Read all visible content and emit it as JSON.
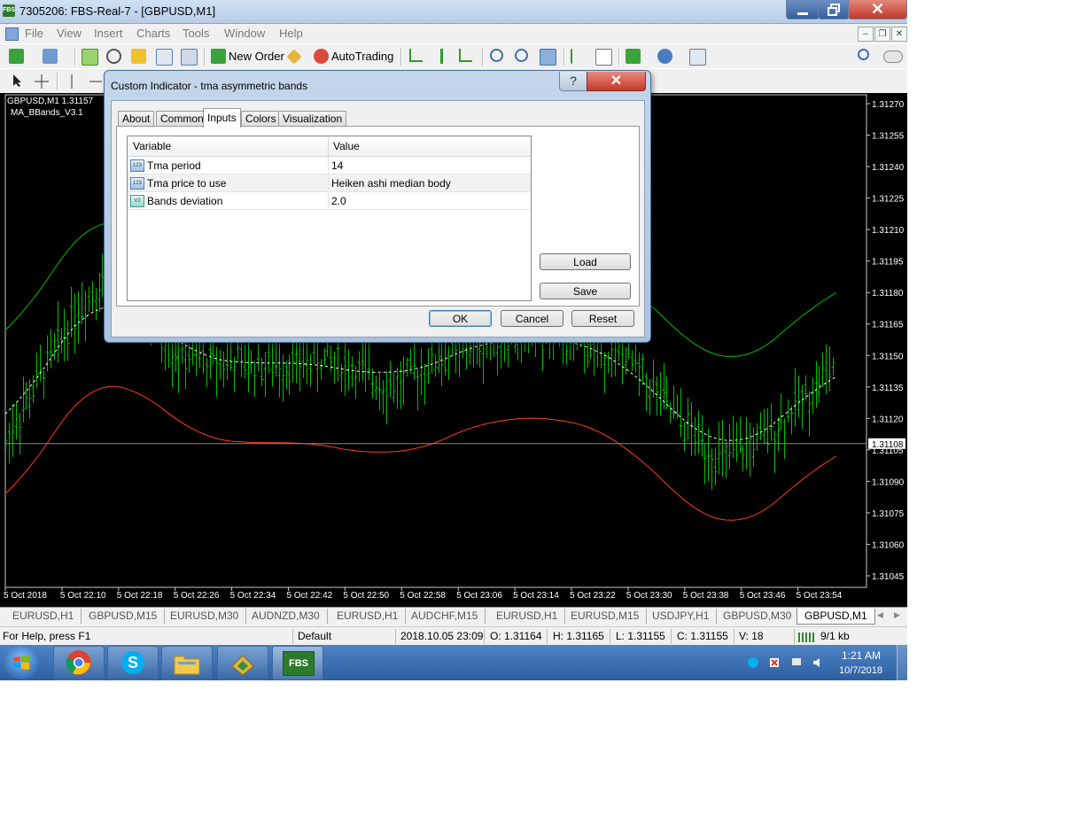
{
  "window": {
    "title": "7305206: FBS-Real-7 - [GBPUSD,M1]",
    "app_icon": "FBS"
  },
  "menu": [
    "File",
    "View",
    "Insert",
    "Charts",
    "Tools",
    "Window",
    "Help"
  ],
  "toolbar": {
    "new_order": "New Order",
    "autotrading": "AutoTrading"
  },
  "chart": {
    "symbol_info": "GBPUSD,M1  1.31157",
    "indicator": "MA_BBands_V3.1",
    "current_price": "1.31108",
    "price_labels": [
      "1.31270",
      "1.31255",
      "1.31240",
      "1.31225",
      "1.31210",
      "1.31195",
      "1.31180",
      "1.31165",
      "1.31150",
      "1.31135",
      "1.31120",
      "1.31105",
      "1.31090",
      "1.31075",
      "1.31060",
      "1.31045"
    ],
    "time_labels": [
      "5 Oct 2018",
      "5 Oct 22:10",
      "5 Oct 22:18",
      "5 Oct 22:26",
      "5 Oct 22:34",
      "5 Oct 22:42",
      "5 Oct 22:50",
      "5 Oct 22:58",
      "5 Oct 23:06",
      "5 Oct 23:14",
      "5 Oct 23:22",
      "5 Oct 23:30",
      "5 Oct 23:38",
      "5 Oct 23:46",
      "5 Oct 23:54"
    ],
    "colors": {
      "background": "#000000",
      "bars": "#00c000",
      "upper_band": "#00c000",
      "middle": "#ffffff",
      "lower_band": "#ff3b1f",
      "price_line": "#888888"
    }
  },
  "tabs": [
    "EURUSD,H1",
    "GBPUSD,M15",
    "EURUSD,M30",
    "AUDNZD,M30",
    "EURUSD,H1",
    "AUDCHF,M15",
    "EURUSD,H1",
    "EURUSD,M15",
    "USDJPY,H1",
    "GBPUSD,M30",
    "GBPUSD,M1"
  ],
  "active_tab": "GBPUSD,M1",
  "status": {
    "help": "For Help, press F1",
    "profile": "Default",
    "datetime": "2018.10.05 23:09",
    "open": "O: 1.31164",
    "high": "H: 1.31165",
    "low": "L: 1.31155",
    "close": "C: 1.31155",
    "volume": "V: 18",
    "traffic": "9/1 kb"
  },
  "taskbar": {
    "clock_time": "1:21 AM",
    "clock_date": "10/7/2018",
    "fbs_label": "FBS"
  },
  "dialog": {
    "title": "Custom Indicator - tma asymmetric bands",
    "tabs": [
      "About",
      "Common",
      "Inputs",
      "Colors",
      "Visualization"
    ],
    "active_tab": "Inputs",
    "columns": {
      "variable": "Variable",
      "value": "Value"
    },
    "rows": [
      {
        "icon": "123",
        "variable": "Tma period",
        "value": "14"
      },
      {
        "icon": "123",
        "variable": "Tma price to use",
        "value": "Heiken ashi median body"
      },
      {
        "icon": "V2",
        "variable": "Bands deviation",
        "value": "2.0"
      }
    ],
    "buttons": {
      "load": "Load",
      "save": "Save",
      "ok": "OK",
      "cancel": "Cancel",
      "reset": "Reset"
    }
  }
}
